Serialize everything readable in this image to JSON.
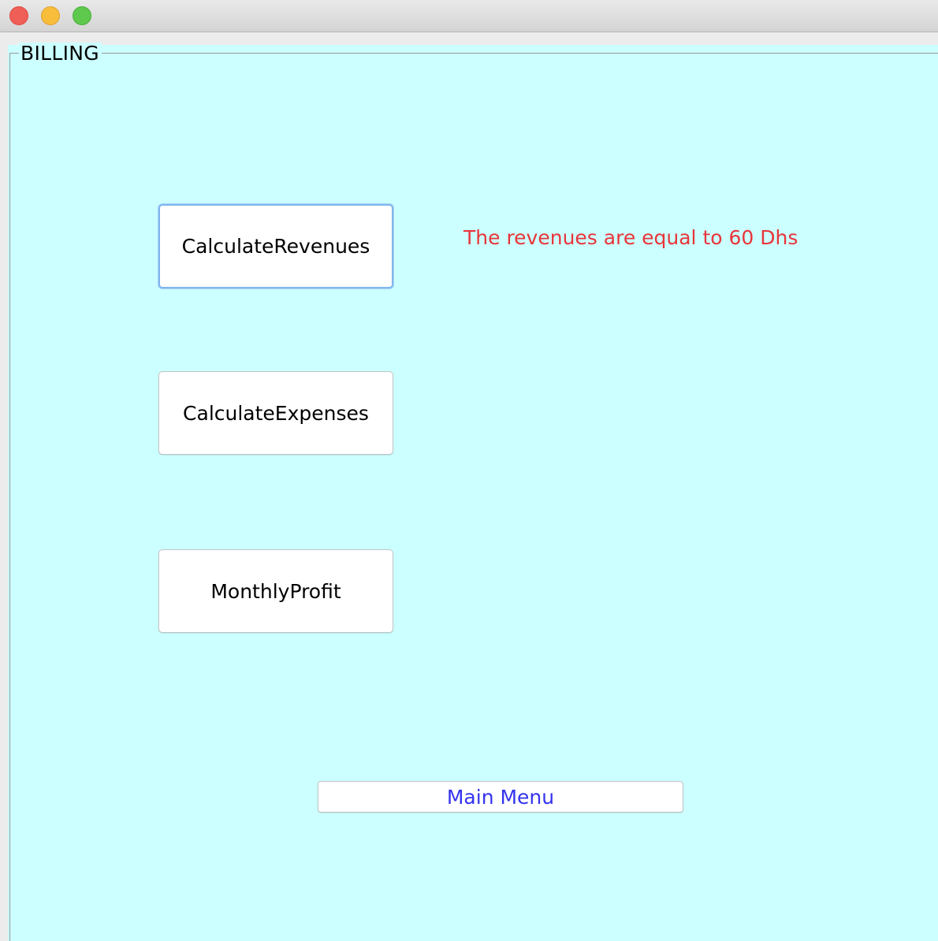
{
  "window": {
    "controls": {
      "close": "close-icon",
      "minimize": "minimize-icon",
      "maximize": "maximize-icon"
    }
  },
  "panel": {
    "title": "BILLING",
    "background_color": "#ccffff"
  },
  "buttons": {
    "calculate_revenues": "CalculateRevenues",
    "calculate_expenses": "CalculateExpenses",
    "monthly_profit": "MonthlyProfit",
    "main_menu": "Main Menu"
  },
  "result": {
    "text": "The revenues are equal to 60 Dhs",
    "color": "#e8353a"
  },
  "colors": {
    "main_menu_text": "#3333ee",
    "focus_ring": "#7fb8ee"
  }
}
